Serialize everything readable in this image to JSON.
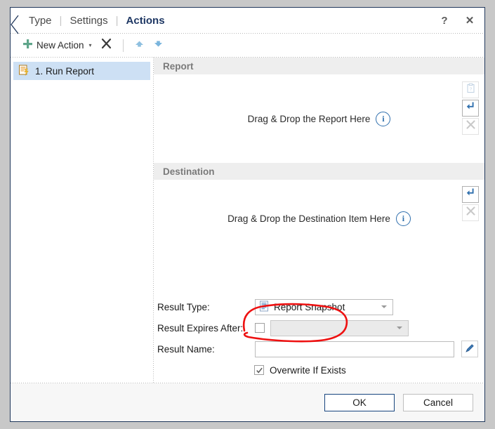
{
  "window": {
    "back_chevron_icon": "chevron-left-icon",
    "help_label": "?",
    "close_label": "✕"
  },
  "tabs": [
    {
      "label": "Type",
      "active": false
    },
    {
      "label": "Settings",
      "active": false
    },
    {
      "label": "Actions",
      "active": true
    }
  ],
  "tab_separator": "|",
  "toolbar": {
    "new_action_label": "New Action",
    "new_action_icon": "plus-icon",
    "new_action_caret": "▾",
    "delete_icon": "x-delete-icon",
    "move_up_icon": "arrow-up-icon",
    "move_down_icon": "arrow-down-icon"
  },
  "actions_list": {
    "items": [
      {
        "label": "1. Run Report",
        "icon": "run-report-icon",
        "selected": true
      }
    ]
  },
  "report_section": {
    "title": "Report",
    "drop_text": "Drag & Drop the Report Here",
    "info_icon_label": "i",
    "buttons": [
      {
        "name": "paste-button",
        "icon": "clipboard-icon",
        "enabled": false
      },
      {
        "name": "insert-button",
        "icon": "arrow-down-hook-icon",
        "enabled": true
      },
      {
        "name": "clear-button",
        "icon": "x-clear-icon",
        "enabled": false
      }
    ]
  },
  "destination_section": {
    "title": "Destination",
    "drop_text": "Drag & Drop the Destination Item Here",
    "info_icon_label": "i",
    "buttons": [
      {
        "name": "insert-button",
        "icon": "arrow-down-hook-icon",
        "enabled": true
      },
      {
        "name": "clear-button",
        "icon": "x-clear-icon",
        "enabled": false
      }
    ]
  },
  "form": {
    "result_type": {
      "label": "Result Type:",
      "value": "Report Snapshot",
      "icon": "document-icon",
      "options": [
        "Report Snapshot"
      ]
    },
    "result_expires_after": {
      "label": "Result Expires After:",
      "checked": false,
      "value": "",
      "disabled": true
    },
    "result_name": {
      "label": "Result Name:",
      "value": "",
      "placeholder": "",
      "edit_icon": "pencil-icon"
    },
    "overwrite_if_exists": {
      "label": "Overwrite If Exists",
      "checked": true,
      "check_glyph": "✓"
    }
  },
  "footer": {
    "ok_label": "OK",
    "cancel_label": "Cancel"
  },
  "annotation": {
    "type": "hand-drawn-ellipse",
    "color": "#ee1111",
    "targets": "overwrite_if_exists"
  },
  "colors": {
    "accent_blue": "#1f3864",
    "selection_blue": "#cde0f4",
    "plus_green": "#5fa58a",
    "icon_blue": "#2f6fad",
    "annotation_red": "#ee1111",
    "section_header_bg": "#eeeeee"
  }
}
